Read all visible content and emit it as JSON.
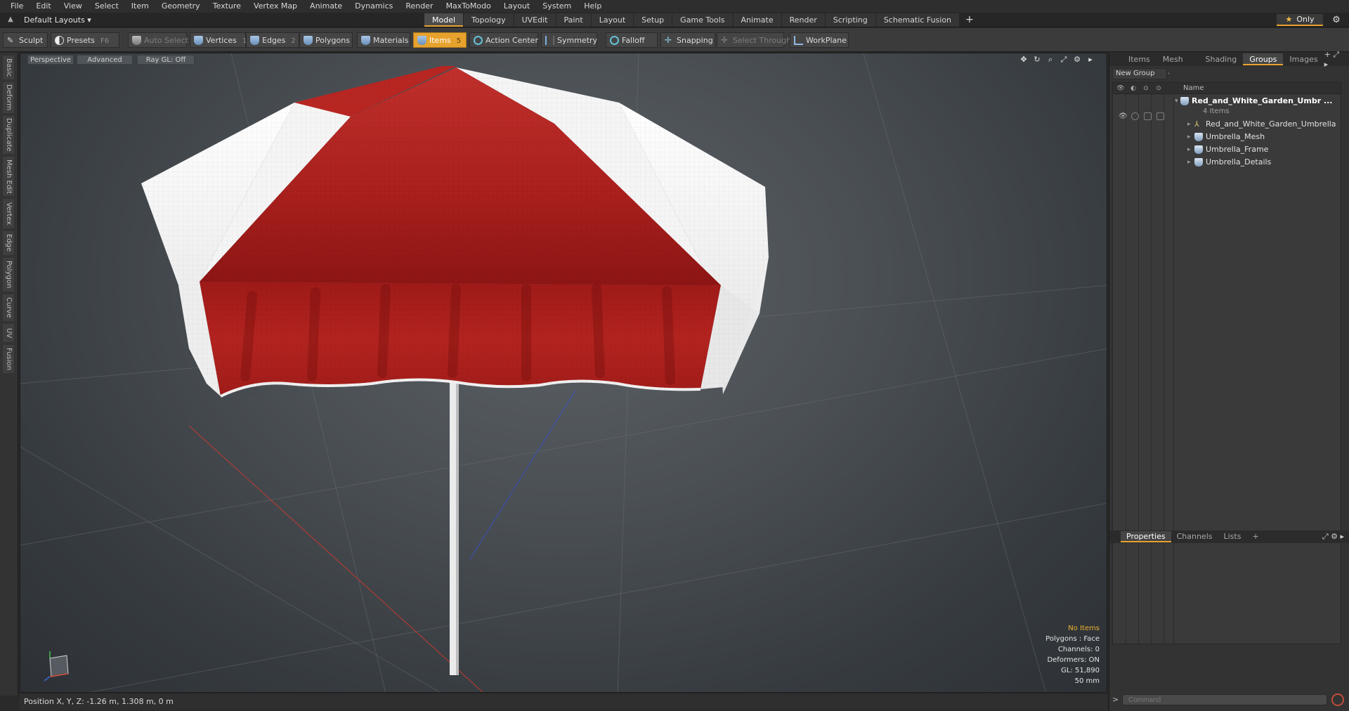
{
  "menu": [
    "File",
    "Edit",
    "View",
    "Select",
    "Item",
    "Geometry",
    "Texture",
    "Vertex Map",
    "Animate",
    "Dynamics",
    "Render",
    "MaxToModo",
    "Layout",
    "System",
    "Help"
  ],
  "layout_bar": {
    "layout_select": "Default Layouts ▾",
    "tabs": [
      "Model",
      "Topology",
      "UVEdit",
      "Paint",
      "Layout",
      "Setup",
      "Game Tools",
      "Animate",
      "Render",
      "Scripting",
      "Schematic Fusion"
    ],
    "active_tab": "Model",
    "add_tab": "+",
    "only_label": "Only",
    "gear": "⚙"
  },
  "toolbar": {
    "sculpt": "Sculpt",
    "presets": "Presets",
    "presets_key": "F6",
    "auto_select": "Auto Select",
    "vertices": "Vertices",
    "vertices_key": "1",
    "edges": "Edges",
    "edges_key": "2",
    "polygons": "Polygons",
    "materials": "Materials",
    "items": "Items",
    "items_key": "5",
    "action_center": "Action Center",
    "symmetry": "Symmetry",
    "falloff": "Falloff",
    "snapping": "Snapping",
    "select_through": "Select Through",
    "workplane": "WorkPlane"
  },
  "left_tabs": [
    "Basic",
    "Deform",
    "Duplicate",
    "Mesh Edit",
    "Vertex",
    "Edge",
    "Polygon",
    "Curve",
    "UV",
    "Fusion"
  ],
  "viewport": {
    "view_mode": "Perspective",
    "shading": "Advanced",
    "raygl": "Ray GL: Off",
    "icons": [
      "✥",
      "↻",
      "⌕",
      "⤢",
      "⚙",
      "▸"
    ],
    "info": {
      "selection": "No Items",
      "polygons": "Polygons : Face",
      "channels": "Channels: 0",
      "deformers": "Deformers: ON",
      "gl": "GL: 51,890",
      "scale": "50 mm"
    }
  },
  "status": {
    "position": "Position X, Y, Z:  -1.26 m, 1.308 m, 0 m"
  },
  "right_panel": {
    "tabs": [
      "Items",
      "Mesh ...",
      "Shading",
      "Groups",
      "Images"
    ],
    "active_tab": "Groups",
    "tab_icons": "+ ⤢ ▸",
    "new_group": "New Group",
    "name_header": "Name",
    "group_name": "Red_and_White_Garden_Umbr ...",
    "group_count": "4 Items",
    "items": [
      "Red_and_White_Garden_Umbrella",
      "Umbrella_Mesh",
      "Umbrella_Frame",
      "Umbrella_Details"
    ],
    "props_tabs": [
      "Properties",
      "Channels",
      "Lists"
    ],
    "props_add": "+",
    "props_icons": "⤢ ⚙ ▸",
    "command_prompt": ">",
    "command_placeholder": "Command"
  },
  "colors": {
    "accent": "#e7a22d",
    "canopy_red": "#b5211f",
    "canopy_white": "#f2f2f2"
  }
}
